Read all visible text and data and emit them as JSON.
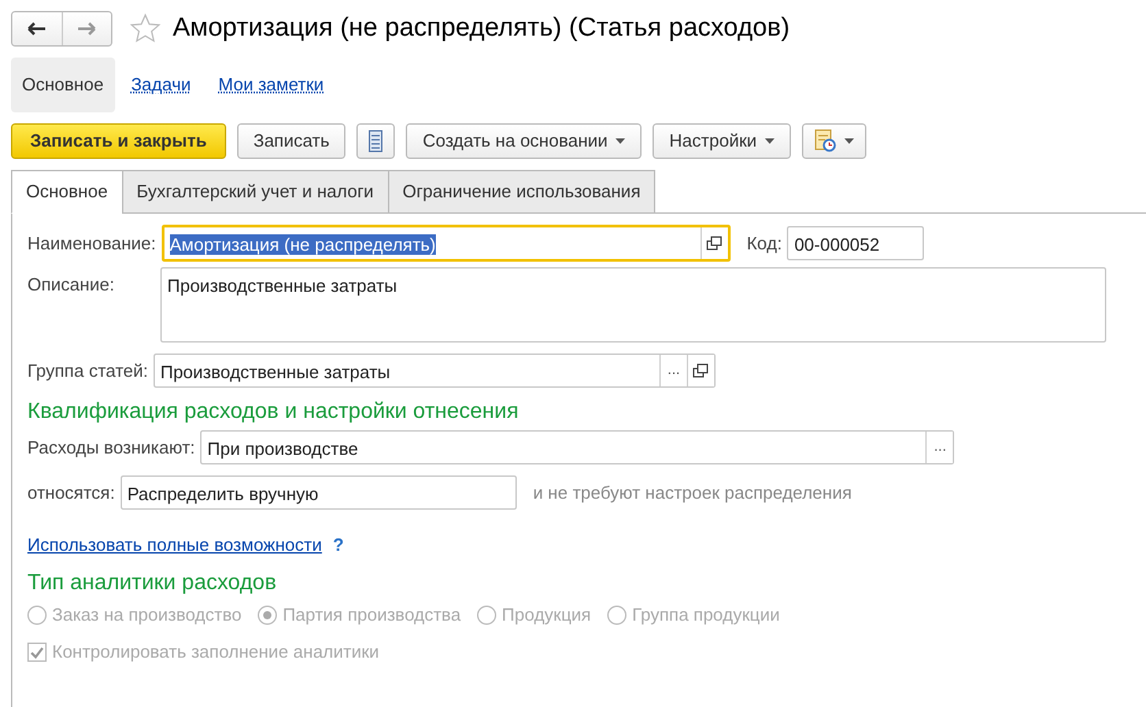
{
  "window": {
    "title": "Амортизация (не распределять) (Статья расходов)",
    "favorite": false
  },
  "sections": [
    {
      "label": "Основное",
      "selected": true
    },
    {
      "label": "Задачи",
      "selected": false
    },
    {
      "label": "Мои заметки",
      "selected": false
    }
  ],
  "toolbar": [
    {
      "kind": "primary",
      "label": "Записать и закрыть"
    },
    {
      "kind": "plain",
      "label": "Записать"
    },
    {
      "kind": "list-icon"
    },
    {
      "kind": "dropdown",
      "label": "Создать на основании"
    },
    {
      "kind": "dropdown",
      "label": "Настройки"
    },
    {
      "kind": "report-dropdown"
    }
  ],
  "tabs": [
    {
      "label": "Основное",
      "selected": true
    },
    {
      "label": "Бухгалтерский учет и налоги",
      "selected": false
    },
    {
      "label": "Ограничение использования",
      "selected": false
    }
  ],
  "name": {
    "label": "Наименование:",
    "value": "Амортизация (не распределять)",
    "text_selected": true,
    "focused": true
  },
  "code": {
    "label": "Код:",
    "value": "00-000052"
  },
  "description": {
    "label": "Описание:",
    "value": "Производственные затраты"
  },
  "group": {
    "label": "Группа статей:",
    "value": "Производственные затраты",
    "choose": "..."
  },
  "qualification": {
    "heading": "Квалификация расходов и настройки отнесения",
    "arise": {
      "label": "Расходы возникают:",
      "value": "При производстве",
      "choose": "..."
    },
    "relate": {
      "label": "относятся:",
      "value": "Распределить вручную",
      "note": "и не требуют настроек распределения"
    }
  },
  "full_link": {
    "label": "Использовать полные возможности",
    "help": "?"
  },
  "analytics": {
    "heading": "Тип аналитики расходов",
    "options": [
      {
        "label": "Заказ на производство",
        "selected": false,
        "disabled": true
      },
      {
        "label": "Партия производства",
        "selected": true,
        "disabled": true
      },
      {
        "label": "Продукция",
        "selected": false,
        "disabled": true
      },
      {
        "label": "Группа продукции",
        "selected": false,
        "disabled": true
      }
    ],
    "control": {
      "label": "Контролировать заполнение аналитики",
      "checked": true,
      "disabled": true
    }
  }
}
